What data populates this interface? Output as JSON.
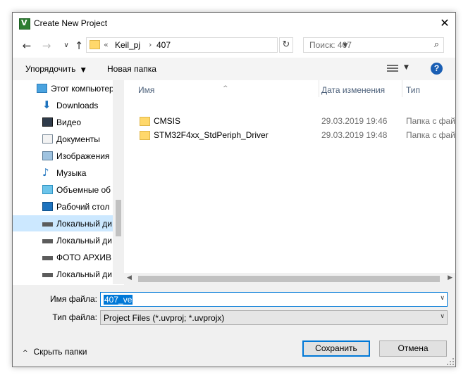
{
  "window": {
    "title": "Create New Project",
    "app_icon_glyph": "V"
  },
  "nav": {
    "path": [
      "Keil_pj",
      "407"
    ],
    "path_prefix": "«",
    "search_placeholder": "Поиск: 407"
  },
  "toolbar": {
    "organize": "Упорядочить",
    "new_folder": "Новая папка"
  },
  "sidebar": {
    "items": [
      {
        "label": "Этот компьютер",
        "icon": "computer-icon"
      },
      {
        "label": "Downloads",
        "icon": "download-icon"
      },
      {
        "label": "Видео",
        "icon": "video-icon"
      },
      {
        "label": "Документы",
        "icon": "documents-icon"
      },
      {
        "label": "Изображения",
        "icon": "pictures-icon"
      },
      {
        "label": "Музыка",
        "icon": "music-icon"
      },
      {
        "label": "Объемные об",
        "icon": "3d-objects-icon"
      },
      {
        "label": "Рабочий стол",
        "icon": "desktop-icon"
      },
      {
        "label": "Локальный ди",
        "icon": "drive-icon",
        "selected": true
      },
      {
        "label": "Локальный ди",
        "icon": "drive-icon"
      },
      {
        "label": "ФОТО АРХИВ",
        "icon": "drive-icon"
      },
      {
        "label": "Локальный ди",
        "icon": "drive-icon"
      }
    ]
  },
  "columns": {
    "name": "Имя",
    "date": "Дата изменения",
    "type": "Тип"
  },
  "files": [
    {
      "name": "CMSIS",
      "date": "29.03.2019 19:46",
      "type": "Папка с фай"
    },
    {
      "name": "STM32F4xx_StdPeriph_Driver",
      "date": "29.03.2019 19:48",
      "type": "Папка с фай"
    }
  ],
  "form": {
    "filename_label": "Имя файла:",
    "filename_value": "407_ve",
    "filetype_label": "Тип файла:",
    "filetype_value": "Project Files (*.uvproj; *.uvprojx)"
  },
  "footer": {
    "hide_folders": "Скрыть папки",
    "save": "Сохранить",
    "cancel": "Отмена"
  },
  "colors": {
    "accent": "#0078d7",
    "selection": "#cce8ff",
    "folder": "#ffd86b",
    "help": "#1a5fb4"
  }
}
